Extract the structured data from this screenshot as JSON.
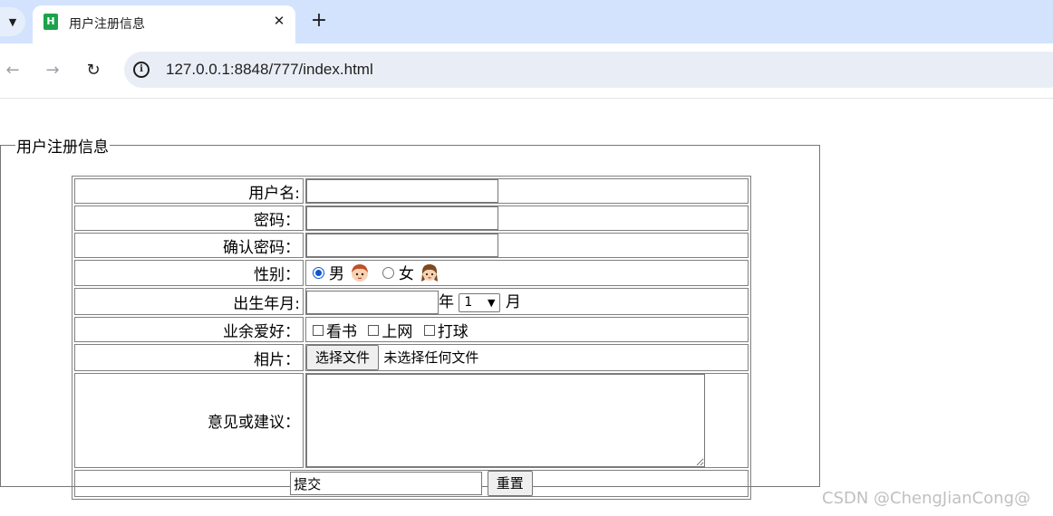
{
  "browser": {
    "tab_title": "用户注册信息",
    "favicon_letter": "H",
    "tab_close_glyph": "✕",
    "new_tab_glyph": "+",
    "url": "127.0.0.1:8848/777/index.html"
  },
  "form": {
    "legend": "用户注册信息",
    "username_label": "用户名:",
    "username_value": "",
    "password_label": "密码：",
    "password_value": "",
    "confirm_label": "确认密码：",
    "confirm_value": "",
    "gender_label": "性别：",
    "gender_male": "男",
    "gender_female": "女",
    "gender_selected": "男",
    "birth_label": "出生年月:",
    "birth_year_value": "",
    "year_unit": "年",
    "month_selected": "1",
    "month_unit": "月",
    "hobby_label": "业余爱好：",
    "hobbies": [
      "看书",
      "上网",
      "打球"
    ],
    "photo_label": "相片：",
    "file_button": "选择文件",
    "file_status": "未选择任何文件",
    "feedback_label": "意见或建议：",
    "feedback_value": "",
    "submit_value": "提交",
    "reset_label": "重置"
  },
  "watermark": "CSDN @ChengJianCong@",
  "colors": {
    "tab_strip": "#d3e3fd",
    "omnibox": "#e9eef6",
    "radio_accent": "#0b57d0",
    "favicon": "#1aa34a"
  }
}
